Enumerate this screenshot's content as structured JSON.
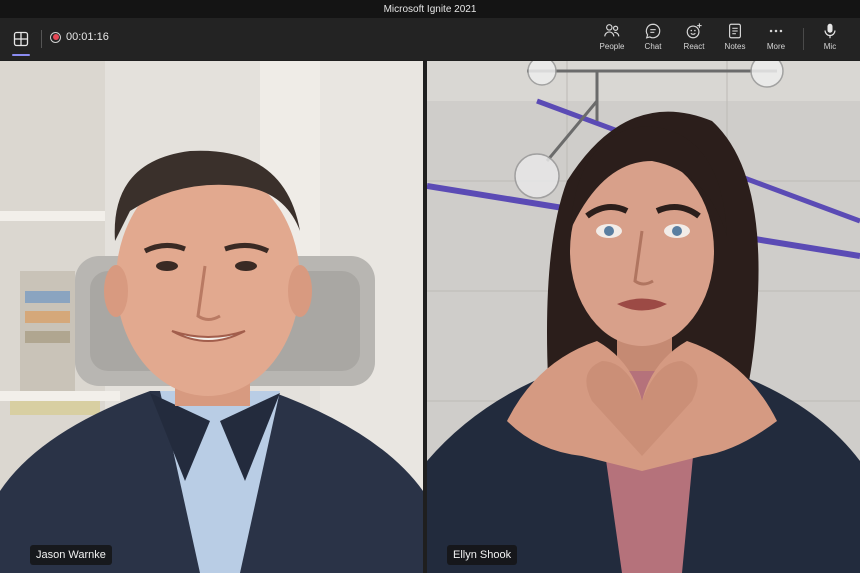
{
  "window": {
    "title": "Microsoft Ignite 2021"
  },
  "recording": {
    "time": "00:01:16"
  },
  "toolbar": {
    "people": "People",
    "chat": "Chat",
    "react": "React",
    "notes": "Notes",
    "more": "More",
    "mic": "Mic"
  },
  "participants": [
    {
      "name": "Jason Warnke"
    },
    {
      "name": "Ellyn Shook"
    }
  ],
  "colors": {
    "accent": "#8b8cf0",
    "recording": "#e74856"
  }
}
